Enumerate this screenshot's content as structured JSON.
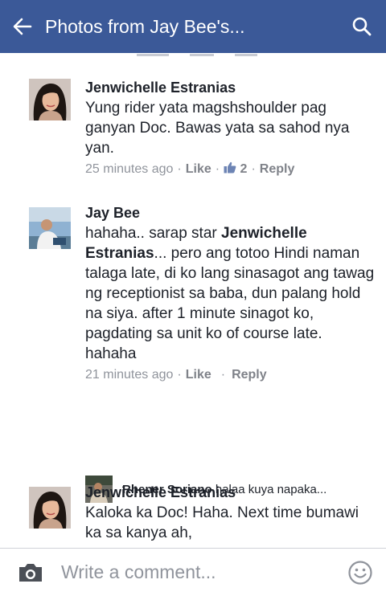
{
  "header": {
    "title": "Photos from Jay Bee's...",
    "bg_color": "#3b5998"
  },
  "comments": [
    {
      "author": "Jenwichelle Estranias",
      "text": "Yung rider yata magshshoulder pag ganyan Doc. Bawas yata sa sahod nya yan.",
      "time": "25 minutes ago",
      "like_label": "Like",
      "like_count": "2",
      "reply_label": "Reply"
    },
    {
      "author": "Jay Bee",
      "text_before": "hahaha.. sarap star ",
      "mention": "Jenwichelle Estranias",
      "text_after": "... pero ang totoo Hindi naman talaga late, di ko lang sinasagot ang tawag ng receptionist sa baba, dun palang hold na siya. after 1 minute sinagot ko, pagdating sa unit ko of course late. hahaha",
      "time": "21 minutes ago",
      "like_label": "Like",
      "reply_label": "Reply",
      "reply_preview": {
        "author": "Rhener Soriano",
        "text": "halaa kuya napaka..."
      }
    },
    {
      "author": "Jenwichelle Estranias",
      "text": "Kaloka ka Doc! Haha. Next time bumawi ka sa kanya ah,"
    }
  ],
  "composer": {
    "placeholder": "Write a comment..."
  },
  "icons": {
    "back": "arrow-left-icon",
    "search": "search-icon",
    "camera": "camera-icon",
    "emoji": "emoji-icon",
    "like": "thumbs-up-icon"
  }
}
